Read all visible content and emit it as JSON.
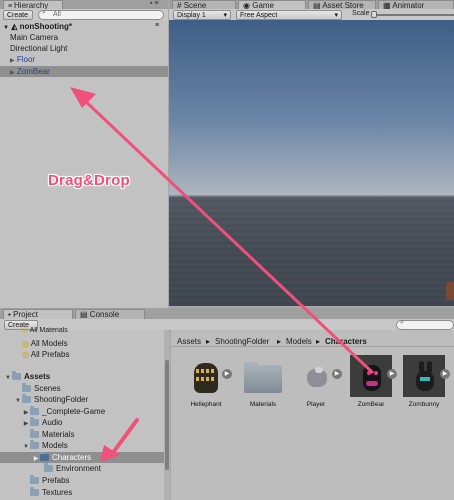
{
  "hierarchy": {
    "tab": "Hierarchy",
    "create_label": "Create",
    "search_placeholder": "All",
    "scene_name": "nonShooting*",
    "items": [
      "Main Camera",
      "Directional Light",
      "Floor",
      "ZomBear"
    ]
  },
  "game": {
    "tabs": [
      "Scene",
      "Game",
      "Asset Store",
      "Animator"
    ],
    "display": "Display 1",
    "aspect": "Free Aspect",
    "scale_label": "Scale"
  },
  "annotation": {
    "label": "Drag&Drop",
    "color": "#f0507a"
  },
  "project": {
    "tabs": [
      "Project",
      "Console"
    ],
    "create_label": "Create",
    "favorites": [
      "All Materials",
      "All Models",
      "All Prefabs"
    ],
    "tree": [
      "Assets",
      "Scenes",
      "ShootingFolder",
      "_Complete-Game",
      "Audio",
      "Materials",
      "Models",
      "Characters",
      "Environment",
      "Prefabs",
      "Textures"
    ],
    "breadcrumb": [
      "Assets",
      "ShootingFolder",
      "Models",
      "Characters"
    ],
    "assets": [
      "Hellephant",
      "Materials",
      "Player",
      "ZomBear",
      "Zombunny"
    ]
  }
}
